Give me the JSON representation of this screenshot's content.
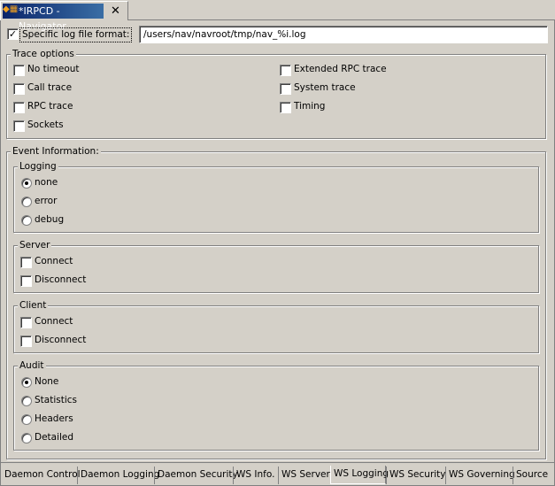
{
  "editor_tab": {
    "title": "*IRPCD - Navigator",
    "icon": "navigator-icon",
    "close": "✕"
  },
  "log_format": {
    "label": "Specific log file format:",
    "checked": true,
    "value": "/users/nav/navroot/tmp/nav_%i.log"
  },
  "trace": {
    "title": "Trace options",
    "items": [
      {
        "label": "No timeout",
        "checked": false
      },
      {
        "label": "Call trace",
        "checked": false
      },
      {
        "label": "RPC trace",
        "checked": false
      },
      {
        "label": "Sockets",
        "checked": false
      },
      {
        "label": "Extended RPC trace",
        "checked": false
      },
      {
        "label": "System trace",
        "checked": false
      },
      {
        "label": "Timing",
        "checked": false
      }
    ]
  },
  "event": {
    "title": "Event Information:",
    "logging": {
      "title": "Logging",
      "options": [
        "none",
        "error",
        "debug"
      ],
      "selected": "none"
    },
    "server": {
      "title": "Server",
      "items": [
        "Connect",
        "Disconnect"
      ]
    },
    "client": {
      "title": "Client",
      "items": [
        "Connect",
        "Disconnect"
      ]
    },
    "audit": {
      "title": "Audit",
      "options": [
        "None",
        "Statistics",
        "Headers",
        "Detailed"
      ],
      "selected": "None"
    }
  },
  "bottom_tabs": [
    "Daemon Control",
    "Daemon Logging",
    "Daemon Security",
    "WS Info.",
    "WS Server",
    "WS Logging",
    "WS Security",
    "WS Governing",
    "Source"
  ],
  "active_tab": "WS Logging",
  "colors": {
    "background": "#d4d0c8",
    "title_active": "#0a246a"
  }
}
